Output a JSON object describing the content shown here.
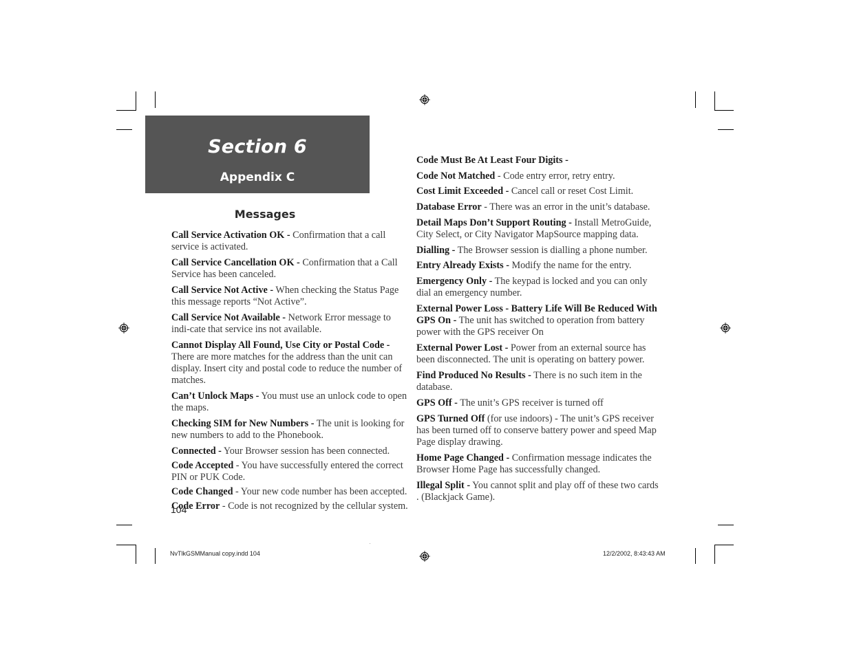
{
  "header": {
    "section_title": "Section 6",
    "subtitle": "Appendix C"
  },
  "messages_heading": "Messages",
  "left_column": [
    {
      "term": "Call Service Activation OK -",
      "desc": " Confirmation that a call service is activated."
    },
    {
      "term": "Call Service Cancellation OK -",
      "desc": " Confirmation that a Call Service has been canceled."
    },
    {
      "term": "Call Service Not Active -",
      "desc": " When checking the Status Page this message reports “Not Active”."
    },
    {
      "term": "Call Service Not Available -",
      "desc": " Network Error message to indi-cate that service ins not available."
    },
    {
      "term": "Cannot Display All Found, Use City or Postal Code -",
      "desc": " There are more matches for the address than the unit can display. Insert city and postal code to reduce the number of matches."
    },
    {
      "term": "Can’t Unlock Maps -",
      "desc": " You must use an unlock code to open the maps."
    },
    {
      "term": "Checking SIM for New Numbers -",
      "desc": " The unit is looking for new numbers to add to the Phonebook."
    },
    {
      "term": "Connected -",
      "desc": " Your Browser session has been connected."
    },
    {
      "term": "Code Accepted",
      "desc": " - You have successfully entered the correct PIN or PUK Code."
    },
    {
      "term": "Code Changed",
      "desc": " - Your new code number has been accepted."
    },
    {
      "term": "Code Error",
      "desc": " - Code is not recognized by the cellular system."
    }
  ],
  "right_column": [
    {
      "term": "Code Must Be At Least Four Digits -",
      "desc": ""
    },
    {
      "term": "Code Not Matched",
      "desc": " - Code entry error, retry entry."
    },
    {
      "term": "Cost Limit Exceeded -",
      "desc": " Cancel call or reset Cost Limit."
    },
    {
      "term": "Database Error",
      "desc": " - There was an error in the unit’s database."
    },
    {
      "term": "Detail Maps Don’t Support Routing -",
      "desc": " Install MetroGuide, City Select, or City Navigator MapSource mapping data."
    },
    {
      "term": "Dialling -",
      "desc": " The Browser session is dialling a phone number."
    },
    {
      "term": "Entry Already Exists -",
      "desc": " Modify the name for the entry."
    },
    {
      "term": "Emergency Only -",
      "desc": " The keypad is locked and you can only dial an emergency number."
    },
    {
      "term": "External Power Loss - Battery Life Will Be Reduced With GPS On -",
      "desc": " The unit has switched to operation from battery power with the GPS receiver On"
    },
    {
      "term": "External Power Lost -",
      "desc": " Power from an external source has been disconnected. The unit is operating on battery power."
    },
    {
      "term": "Find Produced No Results -",
      "desc": " There is no such item in the database."
    },
    {
      "term": "GPS Off -",
      "desc": " The unit’s GPS receiver is turned off"
    },
    {
      "term": "GPS Turned Off",
      "desc": " (for use indoors) - The unit’s GPS receiver has been turned off to conserve battery power and speed Map Page display drawing."
    },
    {
      "term": "Home Page Changed -",
      "desc": " Confirmation message indicates the Browser Home Page has successfully changed."
    },
    {
      "term": "Illegal Split -",
      "desc": " You cannot split and play off of these two cards . (Blackjack Game)."
    }
  ],
  "page_number": "104",
  "slug": {
    "file": "NvTlkGSMManual copy.indd   104",
    "timestamp": "12/2/2002, 8:43:43 AM"
  }
}
